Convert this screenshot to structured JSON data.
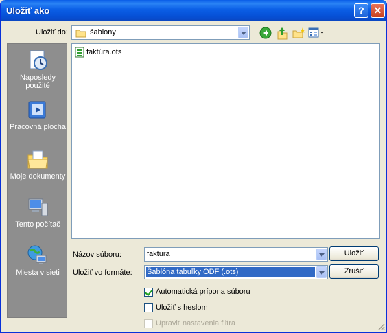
{
  "window": {
    "title": "Uložiť ako",
    "help_glyph": "?",
    "close_glyph": "✕"
  },
  "toolbar": {
    "save_in_label": "Uložiť do:",
    "current_folder": "šablony",
    "icons": [
      "back-icon",
      "up-folder-icon",
      "new-folder-icon",
      "view-menu-icon"
    ]
  },
  "places": [
    {
      "label": "Naposledy použité",
      "icon": "recent-documents-icon"
    },
    {
      "label": "Pracovná plocha",
      "icon": "desktop-icon"
    },
    {
      "label": "Moje dokumenty",
      "icon": "my-documents-icon"
    },
    {
      "label": "Tento počítač",
      "icon": "my-computer-icon"
    },
    {
      "label": "Miesta v sieti",
      "icon": "network-places-icon"
    }
  ],
  "files": [
    {
      "name": "faktúra.ots",
      "icon": "spreadsheet-template-icon"
    }
  ],
  "form": {
    "filename_label": "Názov súboru:",
    "filename_value": "faktúra",
    "format_label": "Uložiť vo formáte:",
    "format_value": "Šablóna tabuľky ODF (.ots)"
  },
  "buttons": {
    "save": "Uložiť",
    "cancel": "Zrušiť"
  },
  "options": [
    {
      "label": "Automatická prípona súboru",
      "checked": true,
      "enabled": true
    },
    {
      "label": "Uložiť s heslom",
      "checked": false,
      "enabled": true
    },
    {
      "label": "Upraviť nastavenia filtra",
      "checked": false,
      "enabled": false
    }
  ],
  "colors": {
    "titlebar": "#0a5ee8",
    "selection": "#316ac5",
    "dialog_bg": "#ece9d8"
  }
}
